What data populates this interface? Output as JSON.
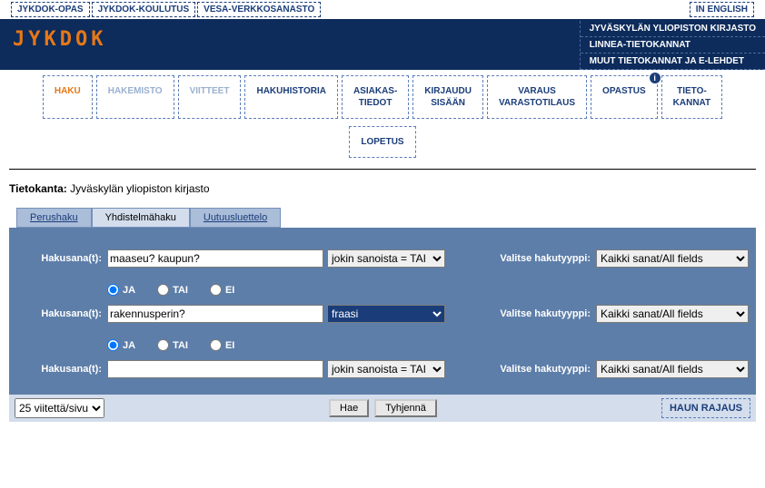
{
  "top_left": [
    "JYKDOK-OPAS",
    "JYKDOK-KOULUTUS",
    "VESA-VERKKOSANASTO"
  ],
  "top_right": [
    "IN ENGLISH"
  ],
  "logo": "JYKDOK",
  "header_links": [
    "JYVÄSKYLÄN YLIOPISTON KIRJASTO",
    "LINNEA-TIETOKANNAT",
    "MUUT TIETOKANNAT JA E-LEHDET"
  ],
  "nav": [
    {
      "label": "HAKU",
      "active": true
    },
    {
      "label": "HAKEMISTO",
      "disabled": true
    },
    {
      "label": "VIITTEET",
      "disabled": true
    },
    {
      "label": "HAKUHISTORIA"
    },
    {
      "label": "ASIAKAS-\nTIEDOT"
    },
    {
      "label": "KIRJAUDU\nSISÄÄN"
    },
    {
      "label": "VARAUS\nVARASTOTILAUS"
    },
    {
      "label": "OPASTUS",
      "info": true
    },
    {
      "label": "TIETO-\nKANNAT"
    }
  ],
  "nav2": [
    {
      "label": "LOPETUS"
    }
  ],
  "db": {
    "label": "Tietokanta:",
    "value": "Jyväskylän yliopiston kirjasto"
  },
  "tabs": [
    {
      "label": "Perushaku"
    },
    {
      "label": "Yhdistelmähaku",
      "active": true
    },
    {
      "label": "Uutuusluettelo"
    }
  ],
  "search": {
    "word_label": "Hakusana(t):",
    "type_label": "Valitse hakutyyppi:",
    "mode_options": [
      "jokin sanoista = TAI",
      "fraasi"
    ],
    "type_options": [
      "Kaikki sanat/All fields"
    ],
    "rows": [
      {
        "value": "maaseu? kaupun?",
        "mode": "jokin sanoista = TAI",
        "type": "Kaikki sanat/All fields"
      },
      {
        "value": "rakennusperin?",
        "mode": "fraasi",
        "mode_hl": true,
        "type": "Kaikki sanat/All fields"
      },
      {
        "value": "",
        "mode": "jokin sanoista = TAI",
        "type": "Kaikki sanat/All fields"
      }
    ],
    "ops": {
      "ja": "JA",
      "tai": "TAI",
      "ei": "EI",
      "sel1": "JA",
      "sel2": "JA"
    }
  },
  "bottom": {
    "per_page": "25 viitettä/sivu",
    "search_btn": "Hae",
    "clear_btn": "Tyhjennä",
    "refine": "HAUN RAJAUS"
  }
}
